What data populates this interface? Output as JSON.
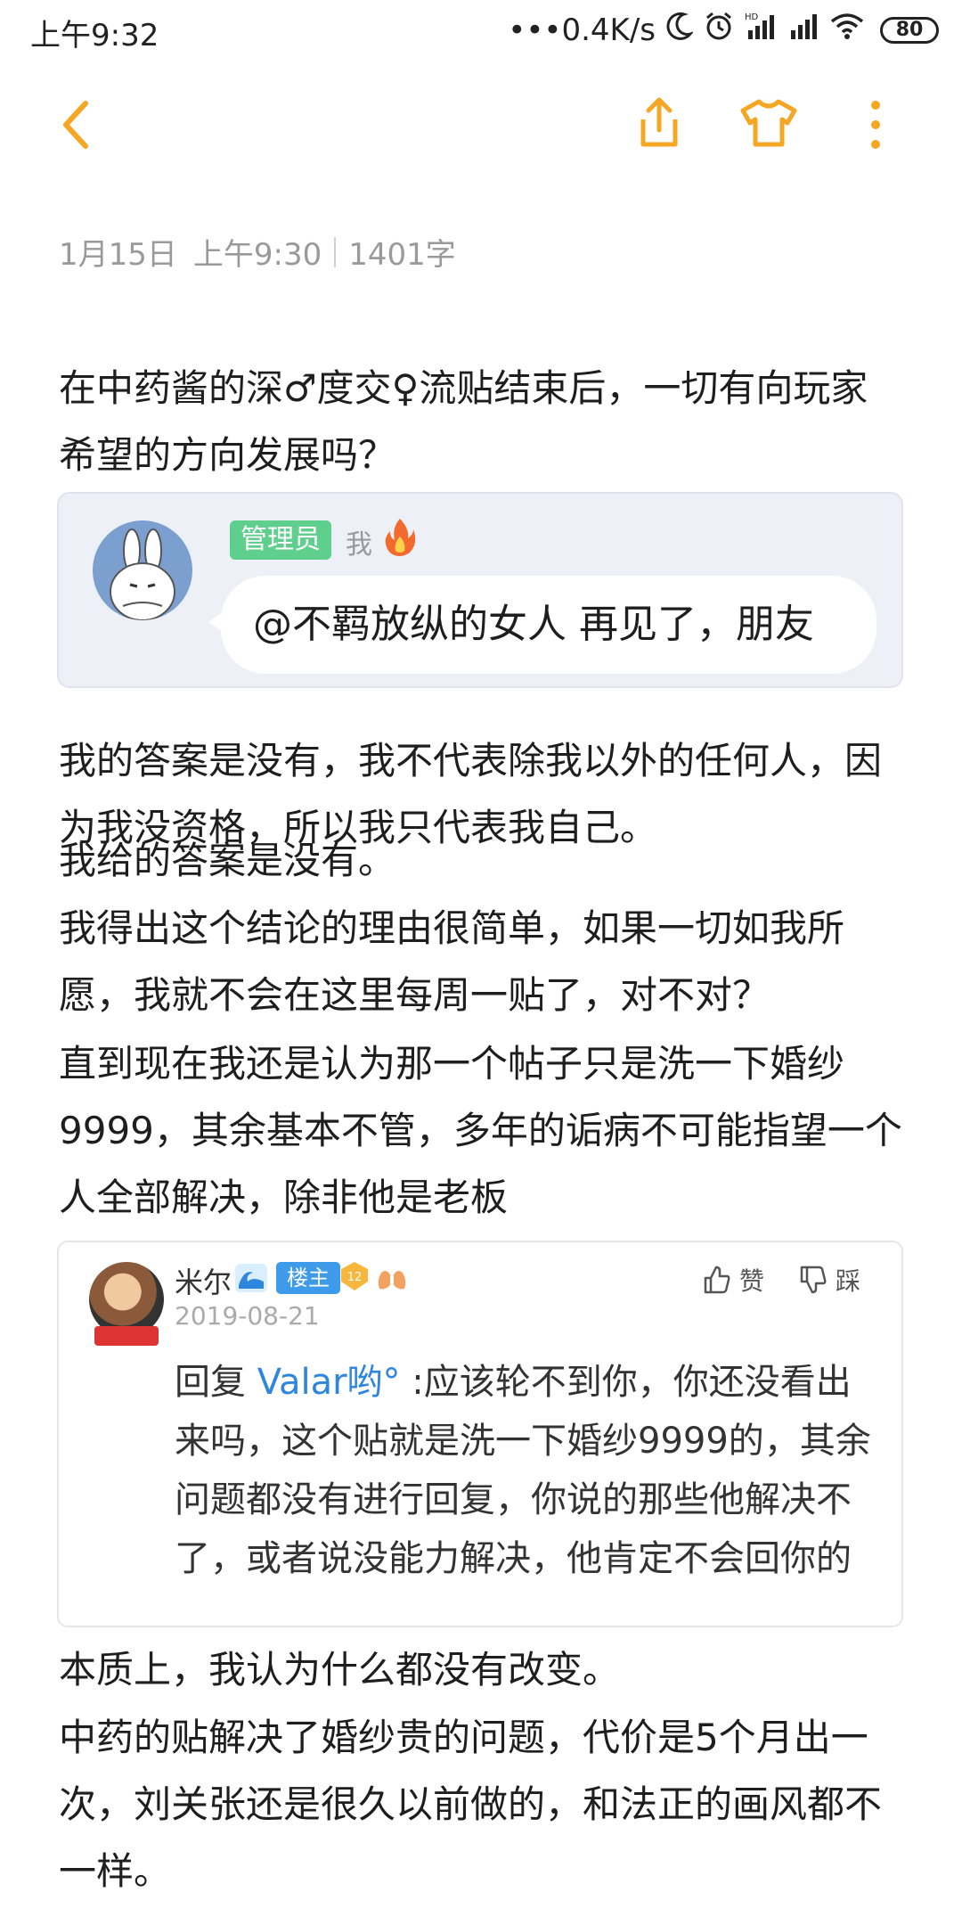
{
  "status_bar": {
    "time": "上午9:32",
    "network_speed": "•••0.4K/s",
    "battery": "80",
    "icons": [
      "moon-icon",
      "alarm-icon",
      "hd-signal-icon",
      "signal-icon",
      "wifi-icon",
      "battery-icon"
    ]
  },
  "toolbar": {
    "icons": [
      "back-icon",
      "share-icon",
      "shirt-icon",
      "more-icon"
    ],
    "accent_color": "#f5a623"
  },
  "meta": {
    "date": "1月15日",
    "time": "上午9:30",
    "word_count": "1401字"
  },
  "paragraphs": {
    "p1": "在中药酱的深♂度交♀流贴结束后，一切有向玩家希望的方向发展吗？",
    "p2": "我的答案是没有，我不代表除我以外的任何人，因为我没资格，所以我只代表我自己。",
    "p3": "我给的答案是没有。",
    "p4": "我得出这个结论的理由很简单，如果一切如我所愿，我就不会在这里每周一贴了，对不对？",
    "p5": "直到现在我还是认为那一个帖子只是洗一下婚纱9999，其余基本不管，多年的诟病不可能指望一个人全部解决，除非他是老板",
    "p6": "本质上，我认为什么都没有改变。",
    "p7": "中药的贴解决了婚纱贵的问题，代价是5个月出一次，刘关张还是很久以前做的，和法正的画风都不一样。"
  },
  "chat_card": {
    "role_badge": "管理员",
    "me_label": "我",
    "message": "@不羁放纵的女人 再见了，朋友",
    "badge_color": "#5fcf8d"
  },
  "quote_card": {
    "user_name": "米尔",
    "louzhu_badge": "楼主",
    "level": "12",
    "date": "2019-08-21",
    "like_label": "赞",
    "dislike_label": "踩",
    "reply_prefix": "回复 ",
    "mention": "Valar哟°",
    "reply_text": " :应该轮不到你，你还没看出来吗，这个贴就是洗一下婚纱9999的，其余问题都没有进行回复，你说的那些他解决不了，或者说没能力解决，他肯定不会回你的",
    "mention_color": "#2e86de"
  }
}
